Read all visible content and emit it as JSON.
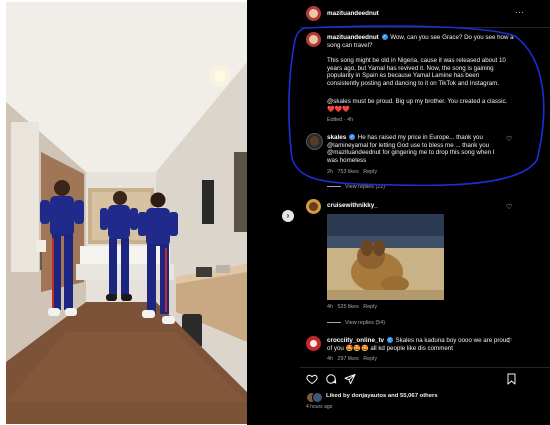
{
  "post": {
    "username": "mazituandeednut",
    "caption_user": "mazituandeednut",
    "caption_line1": "Wow, can you see Grace? Do you see how a",
    "caption_line2": "song can travel?",
    "caption_p2_l1": "This song might be old in Nigeria, cause it was released about 10",
    "caption_p2_l2": "years ago, but Yamal has revived it. Now, the song is gaining",
    "caption_p2_l3": "popularity in Spain es because Yamal Lamine has been",
    "caption_p2_l4": "consistently posting and dancing to it on TikTok and Instagram.",
    "caption_p3_l1": "@skales must be proud. Big up my brother. You created a classic.",
    "caption_hearts": "❤️❤️❤️",
    "caption_meta": "Edited · 4h",
    "likes_text": "Liked by donjayautos and 55,067 others",
    "time_ago": "4 hours ago"
  },
  "comments": [
    {
      "username": "skales",
      "l1": "He has raised my price in Europe... thank you",
      "l2": "@lamineyamal for letting God use to bless me ... thank you",
      "l3": "@mazituandeednut for gingering me to drop this song when I",
      "l4": "was homeless",
      "time": "2h",
      "likes": "753 likes",
      "reply": "Reply",
      "view_replies": "View replies (22)"
    },
    {
      "username": "cruisewithnikky_",
      "time": "4h",
      "likes": "525 likes",
      "reply": "Reply",
      "view_replies": "View replies (54)"
    },
    {
      "username": "crocciity_online_tv",
      "l1": "Skales na kaduna boy oooo we are proud",
      "l2": "of you 🤩🤩🤩 all kd people like dis comment",
      "time": "4h",
      "likes": "297 likes",
      "reply": "Reply"
    }
  ],
  "icons": {
    "more": "more-icon",
    "nav_prev": "chevron-left-icon",
    "like": "heart-icon",
    "comment": "comment-icon",
    "share": "send-icon",
    "save": "bookmark-icon"
  },
  "colors": {
    "annotation_ellipse": "#1a2fd4",
    "verified": "#3797f0",
    "background": "#000000"
  }
}
